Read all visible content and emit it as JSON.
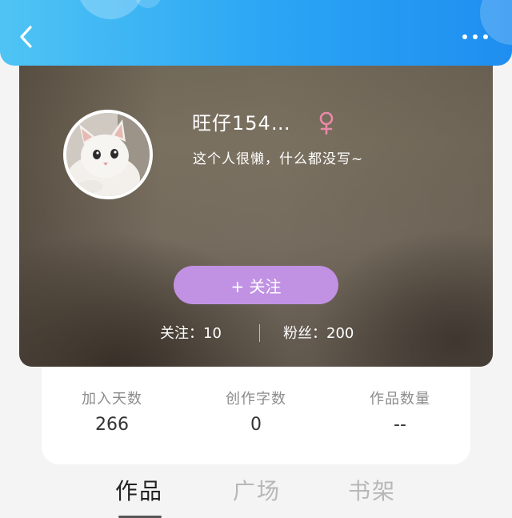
{
  "header": {
    "back_icon": "chevron-left-icon",
    "more_icon": "more-dots-icon"
  },
  "profile": {
    "username": "旺仔154…",
    "gender": "female",
    "gender_color": "#e989a8",
    "bio": "这个人很懒，什么都没写~",
    "follow_button_label": "+ 关注",
    "follow_button_color": "#c192e3",
    "following_label": "关注：10",
    "fans_label": "粉丝：200"
  },
  "stats": [
    {
      "label": "加入天数",
      "value": "266"
    },
    {
      "label": "创作字数",
      "value": "0"
    },
    {
      "label": "作品数量",
      "value": "--"
    }
  ],
  "tabs": [
    {
      "label": "作品",
      "active": true
    },
    {
      "label": "广场",
      "active": false
    },
    {
      "label": "书架",
      "active": false
    }
  ],
  "colors": {
    "header_start": "#4fc4f4",
    "header_end": "#1f8ef0"
  }
}
